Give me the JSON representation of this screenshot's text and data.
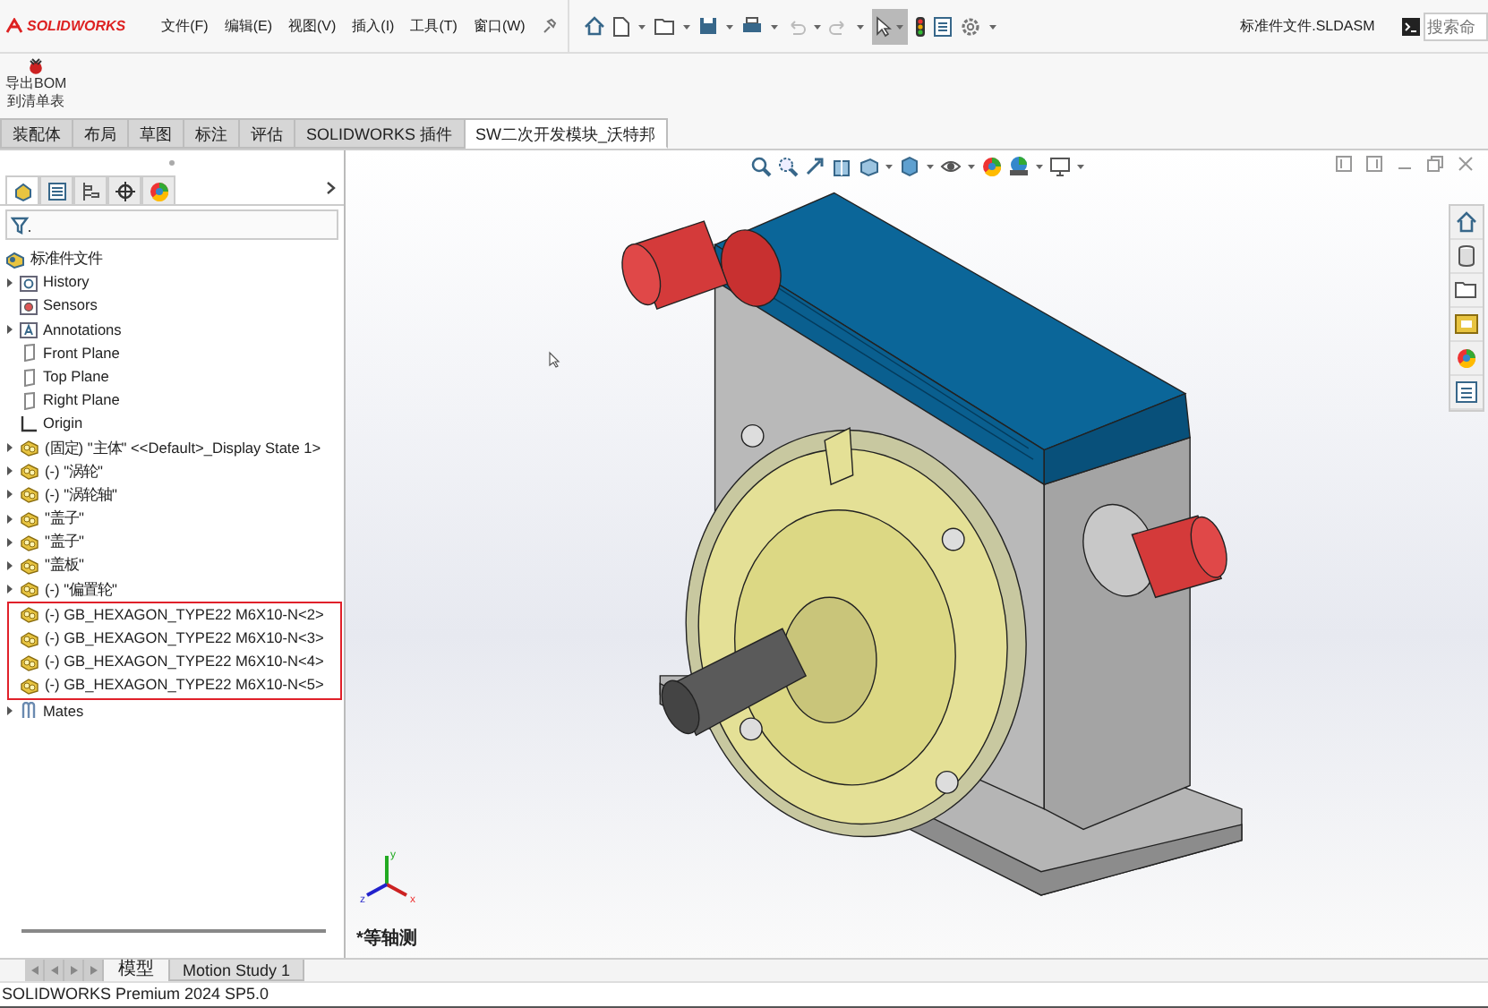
{
  "app": {
    "logo": "SOLIDWORKS"
  },
  "menu": [
    "文件(F)",
    "编辑(E)",
    "视图(V)",
    "插入(I)",
    "工具(T)",
    "窗口(W)"
  ],
  "select_tool": {
    "selected": true
  },
  "document_title": "标准件文件.SLDASM",
  "search": {
    "placeholder": "搜索命"
  },
  "command": {
    "label_lines": [
      "导出BOM",
      "到清单表"
    ]
  },
  "tabs": [
    {
      "label": "装配体",
      "selected": false
    },
    {
      "label": "布局",
      "selected": false
    },
    {
      "label": "草图",
      "selected": false
    },
    {
      "label": "标注",
      "selected": false
    },
    {
      "label": "评估",
      "selected": false
    },
    {
      "label": "SOLIDWORKS 插件",
      "selected": false
    },
    {
      "label": "SW二次开发模块_沃特邦",
      "selected": true
    }
  ],
  "panel_tabs": [
    {
      "kind": "feature-tree",
      "selected": true
    },
    {
      "kind": "property",
      "selected": false
    },
    {
      "kind": "config",
      "selected": false
    },
    {
      "kind": "dimxpert",
      "selected": false
    },
    {
      "kind": "display",
      "selected": false
    }
  ],
  "tree": {
    "root": "标准件文件",
    "items": [
      {
        "label": "History",
        "kind": "history",
        "expandable": true,
        "highlighted": false
      },
      {
        "label": "Sensors",
        "kind": "sensor",
        "expandable": false,
        "highlighted": false
      },
      {
        "label": "Annotations",
        "kind": "annotation",
        "expandable": true,
        "highlighted": false
      },
      {
        "label": "Front Plane",
        "kind": "plane",
        "expandable": false,
        "highlighted": false
      },
      {
        "label": "Top Plane",
        "kind": "plane",
        "expandable": false,
        "highlighted": false
      },
      {
        "label": "Right Plane",
        "kind": "plane",
        "expandable": false,
        "highlighted": false
      },
      {
        "label": "Origin",
        "kind": "origin",
        "expandable": false,
        "highlighted": false
      },
      {
        "label": "(固定) \"主体\" <<Default>_Display State 1>",
        "kind": "part",
        "expandable": true,
        "highlighted": false
      },
      {
        "label": "(-) \"涡轮\"",
        "kind": "part",
        "expandable": true,
        "highlighted": false
      },
      {
        "label": "(-) \"涡轮轴\"",
        "kind": "part",
        "expandable": true,
        "highlighted": false
      },
      {
        "label": "\"盖子\"",
        "kind": "part",
        "expandable": true,
        "highlighted": false
      },
      {
        "label": "\"盖子\"",
        "kind": "part",
        "expandable": true,
        "highlighted": false
      },
      {
        "label": "\"盖板\"",
        "kind": "part",
        "expandable": true,
        "highlighted": false
      },
      {
        "label": "(-) \"偏置轮\"",
        "kind": "part",
        "expandable": true,
        "highlighted": false
      },
      {
        "label": "(-) GB_HEXAGON_TYPE22 M6X10-N<2>",
        "kind": "part",
        "expandable": false,
        "highlighted": true
      },
      {
        "label": "(-) GB_HEXAGON_TYPE22 M6X10-N<3>",
        "kind": "part",
        "expandable": false,
        "highlighted": true
      },
      {
        "label": "(-) GB_HEXAGON_TYPE22 M6X10-N<4>",
        "kind": "part",
        "expandable": false,
        "highlighted": true
      },
      {
        "label": "(-) GB_HEXAGON_TYPE22 M6X10-N<5>",
        "kind": "part",
        "expandable": false,
        "highlighted": true
      },
      {
        "label": "Mates",
        "kind": "mates",
        "expandable": true,
        "highlighted": false
      }
    ]
  },
  "viewport": {
    "view_name": "*等轴测",
    "axes": [
      "x",
      "y",
      "z"
    ]
  },
  "bottom_tabs": [
    {
      "label": "模型",
      "selected": true
    },
    {
      "label": "Motion Study 1",
      "selected": false
    }
  ],
  "status_bar": "SOLIDWORKS Premium 2024 SP5.0"
}
